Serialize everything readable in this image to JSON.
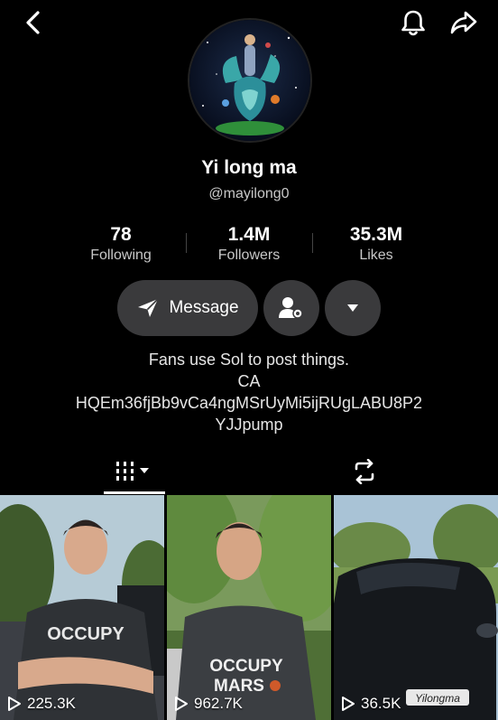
{
  "profile": {
    "name": "Yi long ma",
    "handle": "@mayilong0"
  },
  "stats": [
    {
      "value": "78",
      "label": "Following"
    },
    {
      "value": "1.4M",
      "label": "Followers"
    },
    {
      "value": "35.3M",
      "label": "Likes"
    }
  ],
  "actions": {
    "message_label": "Message"
  },
  "bio": {
    "line1": "Fans use Sol to post things.",
    "line2": "CA",
    "line3": "HQEm36fjBb9vCa4ngMSrUyMi5ijRUgLABU8P2",
    "line4": "YJJpump"
  },
  "videos": [
    {
      "views": "225.3K",
      "shirt_text": "OCCUPY"
    },
    {
      "views": "962.7K",
      "shirt_text": "OCCUPY",
      "shirt_text2": "MARS"
    },
    {
      "views": "36.5K",
      "plate_text": "Yilongma"
    }
  ],
  "icons": {
    "back": "back-chevron-icon",
    "bell": "bell-icon",
    "share": "share-icon",
    "send": "send-icon",
    "add_friend": "add-friend-icon",
    "dropdown": "chevron-down-icon",
    "grid": "grid-icon",
    "repost": "repost-icon",
    "play": "play-icon"
  },
  "colors": {
    "background": "#000000",
    "button": "#3a3a3c",
    "secondary_text": "#c8c8c8"
  }
}
